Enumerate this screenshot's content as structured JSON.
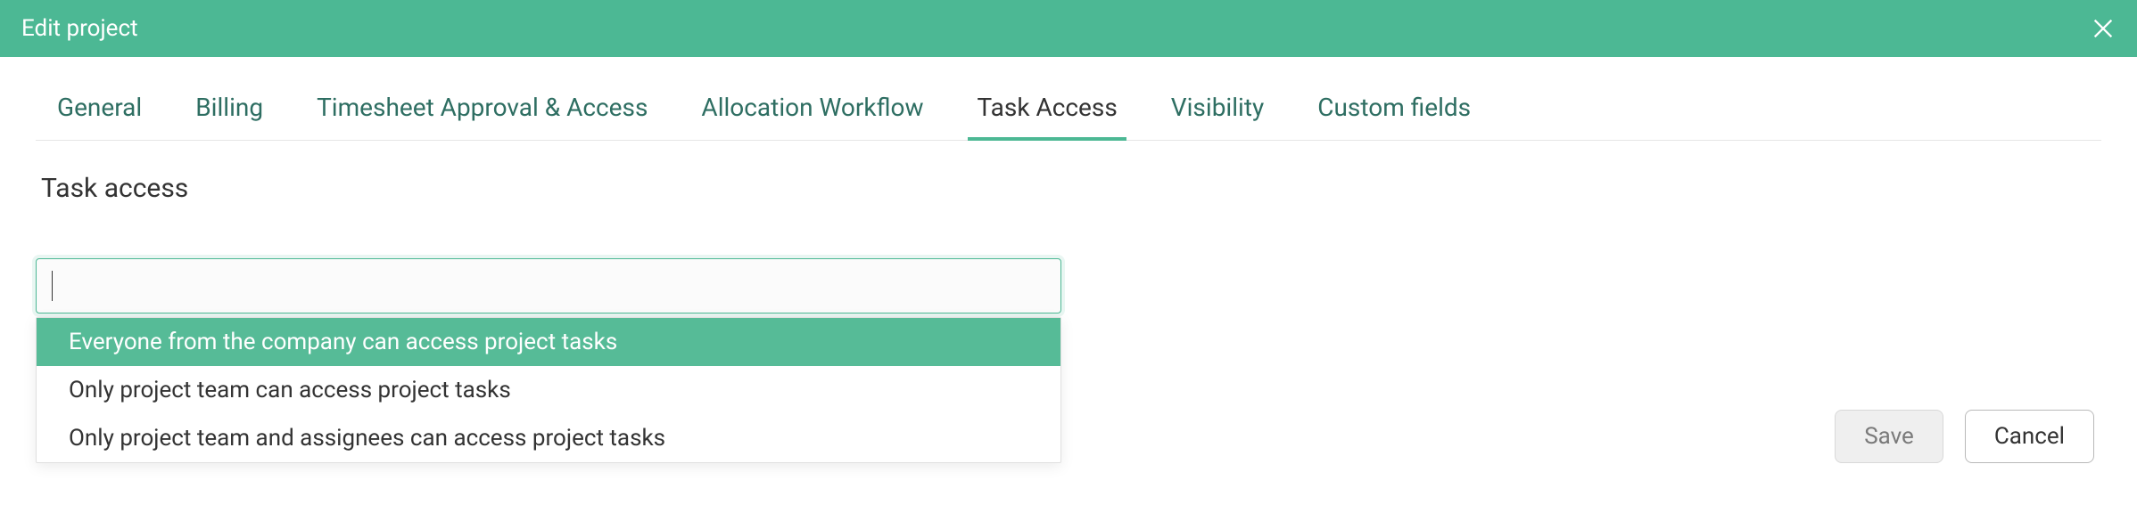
{
  "header": {
    "title": "Edit project"
  },
  "tabs": [
    {
      "label": "General",
      "active": false
    },
    {
      "label": "Billing",
      "active": false
    },
    {
      "label": "Timesheet Approval & Access",
      "active": false
    },
    {
      "label": "Allocation Workflow",
      "active": false
    },
    {
      "label": "Task Access",
      "active": true
    },
    {
      "label": "Visibility",
      "active": false
    },
    {
      "label": "Custom fields",
      "active": false
    }
  ],
  "section": {
    "title": "Task access"
  },
  "select": {
    "value": "",
    "options": [
      {
        "label": "Everyone from the company can access project tasks",
        "highlighted": true
      },
      {
        "label": "Only project team can access project tasks",
        "highlighted": false
      },
      {
        "label": "Only project team and assignees can access project tasks",
        "highlighted": false
      }
    ]
  },
  "footer": {
    "save_label": "Save",
    "cancel_label": "Cancel"
  }
}
